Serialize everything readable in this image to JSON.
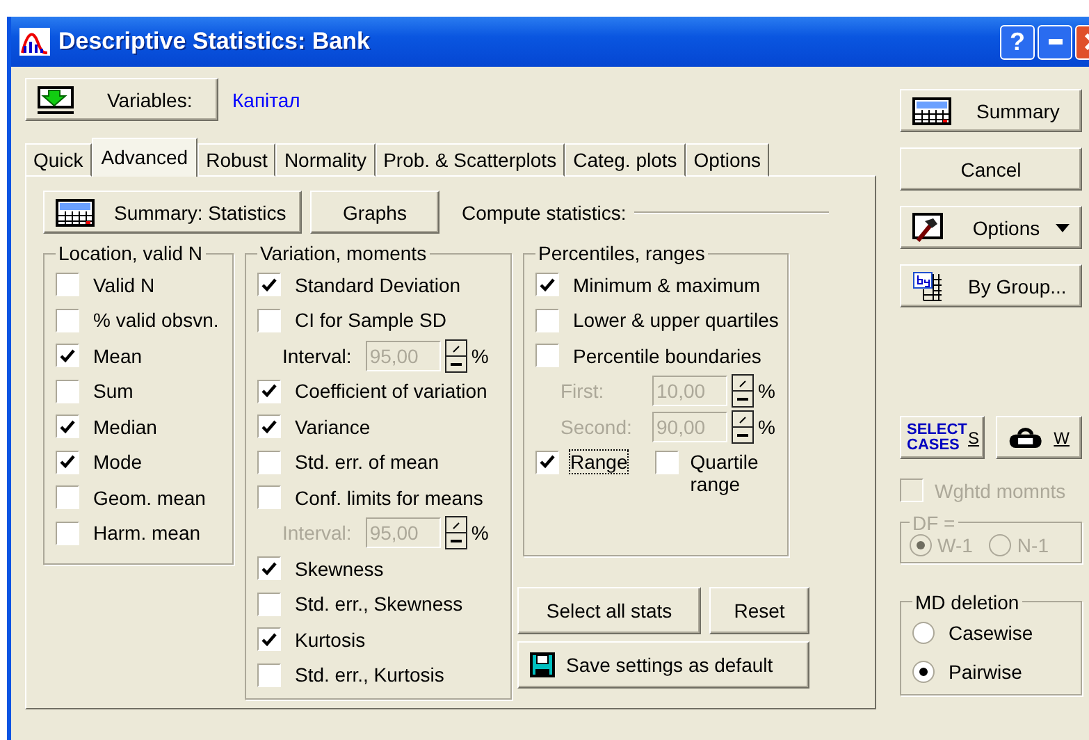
{
  "window": {
    "title": "Descriptive Statistics: Bank",
    "controls": [
      "?"
    ]
  },
  "variables": {
    "button": "Variables:",
    "value": "Капітал"
  },
  "tabs": [
    {
      "label": "Quick",
      "selected": false
    },
    {
      "label": "Advanced",
      "selected": true
    },
    {
      "label": "Robust",
      "selected": false
    },
    {
      "label": "Normality",
      "selected": false
    },
    {
      "label": "Prob. & Scatterplots",
      "selected": false
    },
    {
      "label": "Categ. plots",
      "selected": false
    },
    {
      "label": "Options",
      "selected": false
    }
  ],
  "toolbar": {
    "summary_button": "Summary: Statistics",
    "graphs_button": "Graphs",
    "compute_label": "Compute statistics:"
  },
  "location": {
    "title": "Location, valid N",
    "items": [
      {
        "label": "Valid N",
        "checked": false
      },
      {
        "label": "% valid obsvn.",
        "checked": false
      },
      {
        "label": "Mean",
        "checked": true
      },
      {
        "label": "Sum",
        "checked": false
      },
      {
        "label": "Median",
        "checked": true
      },
      {
        "label": "Mode",
        "checked": true
      },
      {
        "label": "Geom. mean",
        "checked": false
      },
      {
        "label": "Harm. mean",
        "checked": false
      }
    ]
  },
  "variation": {
    "title": "Variation, moments",
    "items": [
      {
        "kind": "checkbox",
        "label": "Standard Deviation",
        "checked": true
      },
      {
        "kind": "checkbox",
        "label": "CI for Sample SD",
        "checked": false
      },
      {
        "kind": "interval",
        "label": "Interval:",
        "value": "95,00",
        "unit": "%",
        "disabled": false
      },
      {
        "kind": "checkbox",
        "label": "Coefficient of variation",
        "checked": true
      },
      {
        "kind": "checkbox",
        "label": "Variance",
        "checked": true
      },
      {
        "kind": "checkbox",
        "label": "Std. err. of mean",
        "checked": false
      },
      {
        "kind": "checkbox",
        "label": "Conf. limits for means",
        "checked": false
      },
      {
        "kind": "interval",
        "label": "Interval:",
        "value": "95,00",
        "unit": "%",
        "disabled": true
      },
      {
        "kind": "checkbox",
        "label": "Skewness",
        "checked": true
      },
      {
        "kind": "checkbox",
        "label": "Std. err., Skewness",
        "checked": false
      },
      {
        "kind": "checkbox",
        "label": "Kurtosis",
        "checked": true
      },
      {
        "kind": "checkbox",
        "label": "Std. err., Kurtosis",
        "checked": false
      }
    ]
  },
  "percentiles": {
    "title": "Percentiles, ranges",
    "items": [
      {
        "kind": "checkbox",
        "label": "Minimum & maximum",
        "checked": true
      },
      {
        "kind": "checkbox",
        "label": "Lower & upper quartiles",
        "checked": false
      },
      {
        "kind": "checkbox",
        "label": "Percentile boundaries",
        "checked": false
      },
      {
        "kind": "interval",
        "label": "First:",
        "value": "10,00",
        "unit": "%",
        "disabled": true
      },
      {
        "kind": "interval",
        "label": "Second:",
        "value": "90,00",
        "unit": "%",
        "disabled": true
      }
    ],
    "range": {
      "label": "Range",
      "checked": true
    },
    "quartile_range": {
      "label": "Quartile range",
      "checked": false
    }
  },
  "buttons": {
    "select_all": "Select all stats",
    "reset": "Reset",
    "save_default": "Save settings as default"
  },
  "side": {
    "summary": "Summary",
    "cancel": "Cancel",
    "options": "Options",
    "by_group": "By Group...",
    "select_cases": {
      "icon_text": "SELECT CASES",
      "key": "S"
    },
    "weights": {
      "key": "W"
    },
    "weighted_moments": {
      "label": "Wghtd momnts",
      "checked": false,
      "disabled": true
    },
    "df": {
      "title": "DF =",
      "disabled": true,
      "options": [
        {
          "label": "W-1",
          "selected": true
        },
        {
          "label": "N-1",
          "selected": false
        }
      ]
    },
    "md_deletion": {
      "title": "MD deletion",
      "options": [
        {
          "label": "Casewise",
          "selected": false
        },
        {
          "label": "Pairwise",
          "selected": true
        }
      ]
    }
  }
}
